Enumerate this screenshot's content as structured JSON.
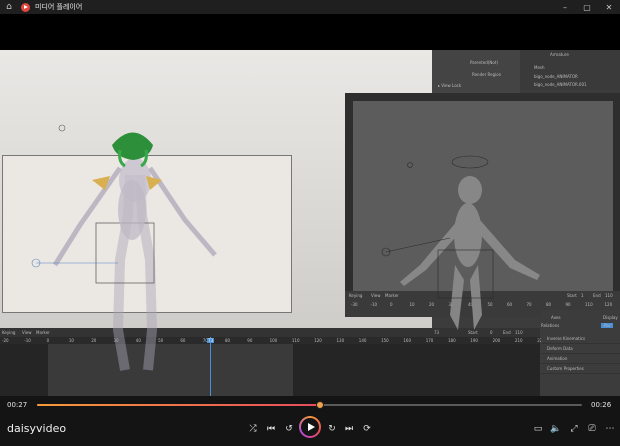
{
  "window": {
    "title": "미디어 플레이어",
    "home_icon": "home-icon",
    "app_icon": "media-player-icon",
    "minimize": "–",
    "maximize": "▢",
    "close": "✕"
  },
  "video_content": {
    "properties_panel": [
      "Parented(Not)",
      "Render Region",
      "▸ View Lock",
      "Lock to Object"
    ],
    "outliner_items": [
      "Armature",
      "Mesh",
      "bigo_node_ANIMATOR",
      "bigo_node_ANIMATOR.001"
    ],
    "timeline_header": [
      "Keying",
      "View",
      "Marker"
    ],
    "timeline_fields": {
      "frame": "73",
      "start_label": "Start",
      "start": "0",
      "end_label": "End",
      "end": "110"
    },
    "ruler_ticks": [
      "-20",
      "-10",
      "0",
      "10",
      "20",
      "30",
      "40",
      "50",
      "60",
      "70",
      "80",
      "90",
      "100",
      "110",
      "120",
      "130",
      "140",
      "150",
      "160",
      "170",
      "180",
      "190",
      "200",
      "210",
      "220"
    ],
    "ruler_current": "73",
    "overlay_timeline_header": [
      "Keying",
      "View",
      "Marker"
    ],
    "overlay_ruler_ticks": [
      "-30",
      "-10",
      "0",
      "10",
      "20",
      "30",
      "40",
      "50",
      "60",
      "70",
      "80",
      "90",
      "110",
      "120"
    ],
    "overlay_ruler_current": "100",
    "overlay_fields": {
      "start_label": "Start",
      "start": "1",
      "end_label": "End",
      "end": "110"
    },
    "prop_labels": {
      "axes": "Axes",
      "relations": "Relations",
      "axes_value": "Display",
      "relations_value": "Par"
    },
    "prop_rows": [
      "Inverse Kinematics",
      "Deform Data",
      "Animation",
      "Custom Properties"
    ]
  },
  "controls": {
    "current_time": "00:27",
    "total_time": "00:26",
    "progress": 0.52,
    "brand": "daisyvideo",
    "left_buttons": [
      {
        "name": "shuffle-icon",
        "glyph": "⤮"
      },
      {
        "name": "previous-icon",
        "glyph": "⏮"
      },
      {
        "name": "rewind-10-icon",
        "glyph": "↺"
      }
    ],
    "right_buttons": [
      {
        "name": "forward-30-icon",
        "glyph": "↻"
      },
      {
        "name": "next-icon",
        "glyph": "⏭"
      },
      {
        "name": "repeat-off-icon",
        "glyph": "⟳"
      }
    ],
    "extra_buttons": [
      {
        "name": "subtitles-icon",
        "glyph": "▭"
      },
      {
        "name": "volume-icon",
        "glyph": "🔈"
      },
      {
        "name": "fullscreen-icon",
        "glyph": "⤢"
      },
      {
        "name": "cast-icon",
        "glyph": "⎚"
      },
      {
        "name": "more-icon",
        "glyph": "⋯"
      }
    ],
    "colors": {
      "accent_start": "#f59a3a",
      "accent_end": "#e84c5c",
      "playhead": "#4b8fd6"
    }
  }
}
